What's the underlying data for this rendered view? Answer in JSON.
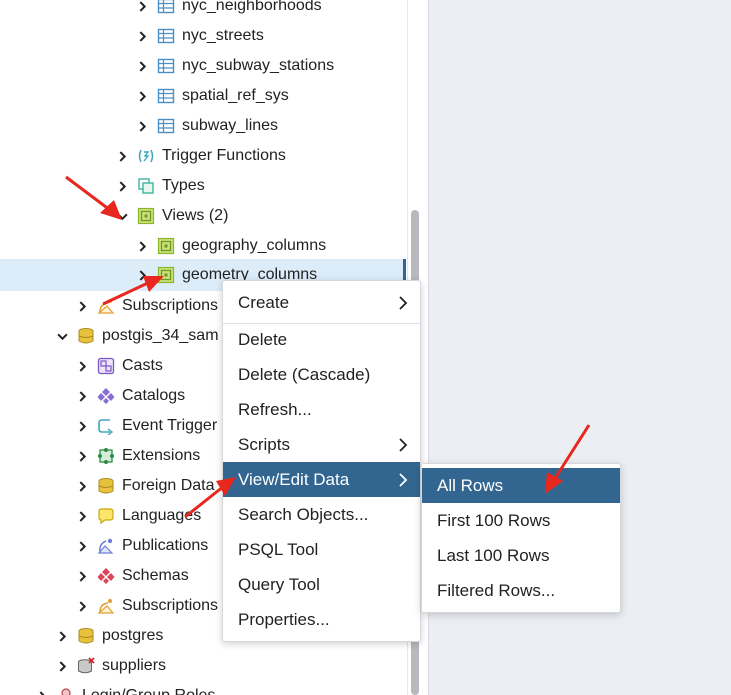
{
  "tree": {
    "items": [
      {
        "label": "nyc_neighborhoods",
        "icon": "table-icon"
      },
      {
        "label": "nyc_streets",
        "icon": "table-icon"
      },
      {
        "label": "nyc_subway_stations",
        "icon": "table-icon"
      },
      {
        "label": "spatial_ref_sys",
        "icon": "table-icon"
      },
      {
        "label": "subway_lines",
        "icon": "table-icon"
      },
      {
        "label": "Trigger Functions",
        "icon": "trigger-function-icon"
      },
      {
        "label": "Types",
        "icon": "types-icon"
      },
      {
        "label": "Views (2)",
        "icon": "views-icon"
      },
      {
        "label": "geography_columns",
        "icon": "view-icon"
      },
      {
        "label": "geometry_columns",
        "icon": "view-icon"
      },
      {
        "label": "Subscriptions",
        "icon": "subscription-icon"
      },
      {
        "label": "postgis_34_sam",
        "icon": "database-icon"
      },
      {
        "label": "Casts",
        "icon": "cast-icon"
      },
      {
        "label": "Catalogs",
        "icon": "catalog-icon"
      },
      {
        "label": "Event Trigger",
        "icon": "event-trigger-icon"
      },
      {
        "label": "Extensions",
        "icon": "extension-icon"
      },
      {
        "label": "Foreign Data",
        "icon": "foreign-data-icon"
      },
      {
        "label": "Languages",
        "icon": "language-icon"
      },
      {
        "label": "Publications",
        "icon": "publication-icon"
      },
      {
        "label": "Schemas",
        "icon": "schema-icon"
      },
      {
        "label": "Subscriptions",
        "icon": "subscription-icon"
      },
      {
        "label": "postgres",
        "icon": "database-icon"
      },
      {
        "label": "suppliers",
        "icon": "database-disconnected-icon"
      },
      {
        "label": "Login/Group Roles",
        "icon": "roles-icon"
      }
    ]
  },
  "context_menu": {
    "items": [
      {
        "label": "Create",
        "submenu": true
      },
      {
        "label": "Delete"
      },
      {
        "label": "Delete (Cascade)"
      },
      {
        "label": "Refresh..."
      },
      {
        "label": "Scripts",
        "submenu": true
      },
      {
        "label": "View/Edit Data",
        "submenu": true,
        "active": true
      },
      {
        "label": "Search Objects..."
      },
      {
        "label": "PSQL Tool"
      },
      {
        "label": "Query Tool"
      },
      {
        "label": "Properties..."
      }
    ]
  },
  "submenu": {
    "items": [
      {
        "label": "All Rows",
        "active": true
      },
      {
        "label": "First 100 Rows"
      },
      {
        "label": "Last 100 Rows"
      },
      {
        "label": "Filtered Rows..."
      }
    ]
  },
  "colors": {
    "accent": "#326690",
    "selection": "#dcecf9",
    "annotation_arrow": "#e8281e"
  }
}
